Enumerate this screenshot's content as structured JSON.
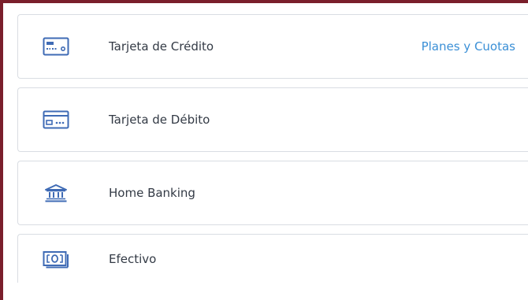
{
  "payment_methods": [
    {
      "icon": "credit-card-icon",
      "label": "Tarjeta de Crédito",
      "link": "Planes y Cuotas"
    },
    {
      "icon": "debit-card-icon",
      "label": "Tarjeta de Débito"
    },
    {
      "icon": "bank-icon",
      "label": "Home Banking"
    },
    {
      "icon": "cash-icon",
      "label": "Efectivo"
    }
  ],
  "colors": {
    "icon_blue": "#3f6bb5",
    "link_blue": "#3a8fd6",
    "text": "#333a45",
    "border": "#d9dde3",
    "frame": "#7a1f2b"
  }
}
